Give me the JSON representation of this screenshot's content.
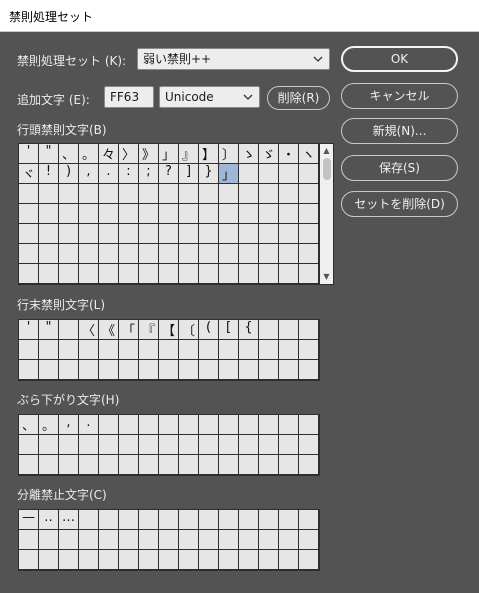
{
  "window": {
    "title": "禁則処理セット"
  },
  "set_row": {
    "label": "禁則処理セット (K):",
    "value": "弱い禁則++"
  },
  "add_row": {
    "label": "追加文字 (E):",
    "code_value": "FF63",
    "encoding": "Unicode",
    "delete_label": "削除(R)"
  },
  "buttons": {
    "ok": "OK",
    "cancel": "キャンセル",
    "new": "新規(N)...",
    "save": "保存(S)",
    "delete_set": "セットを削除(D)"
  },
  "sections": {
    "line_start": {
      "label": "行頭禁則文字(B)",
      "cells": [
        "'",
        "\"",
        "、",
        "。",
        "々",
        "〉",
        "》",
        "」",
        "』",
        "】",
        "〕",
        "ゝ",
        "ゞ",
        "・",
        "ヽ",
        "ヾ",
        "!",
        ")",
        ",",
        ".",
        ":",
        ";",
        "?",
        "]",
        "}",
        "」"
      ]
    },
    "line_end": {
      "label": "行末禁則文字(L)",
      "cells": [
        "'",
        "\"",
        "",
        "〈",
        "《",
        "「",
        "『",
        "【",
        "〔",
        "(",
        "[",
        "{"
      ]
    },
    "hanging": {
      "label": "ぶら下がり文字(H)",
      "cells": [
        "、",
        "。",
        ",",
        "."
      ]
    },
    "no_break": {
      "label": "分離禁止文字(C)",
      "cells": [
        "—",
        "‥",
        "…"
      ]
    }
  }
}
